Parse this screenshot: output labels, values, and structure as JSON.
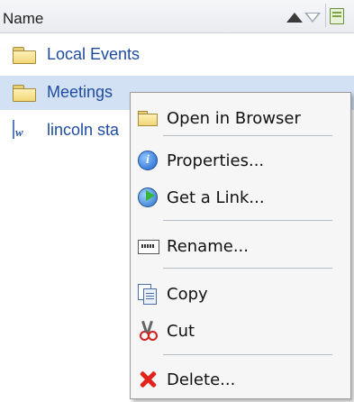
{
  "header": {
    "name_label": "Name"
  },
  "rows": [
    {
      "label": "Local Events",
      "icon": "folder-icon"
    },
    {
      "label": "Meetings",
      "icon": "folder-icon",
      "selected": true
    },
    {
      "label": "lincoln sta",
      "icon": "word-document-icon"
    }
  ],
  "context_menu": {
    "items": [
      {
        "label": "Open in Browser",
        "icon": "open-folder-icon"
      },
      {
        "label": "Properties...",
        "icon": "info-icon"
      },
      {
        "label": "Get a Link...",
        "icon": "globe-link-icon"
      },
      {
        "label": "Rename...",
        "icon": "rename-icon"
      },
      {
        "label": "Copy",
        "icon": "copy-icon"
      },
      {
        "label": "Cut",
        "icon": "scissors-icon"
      },
      {
        "label": "Delete...",
        "icon": "delete-icon"
      }
    ]
  },
  "colors": {
    "selection": "#d2e2f4",
    "link_text": "#1f4ba0",
    "menu_bg": "#f6f6f6"
  }
}
